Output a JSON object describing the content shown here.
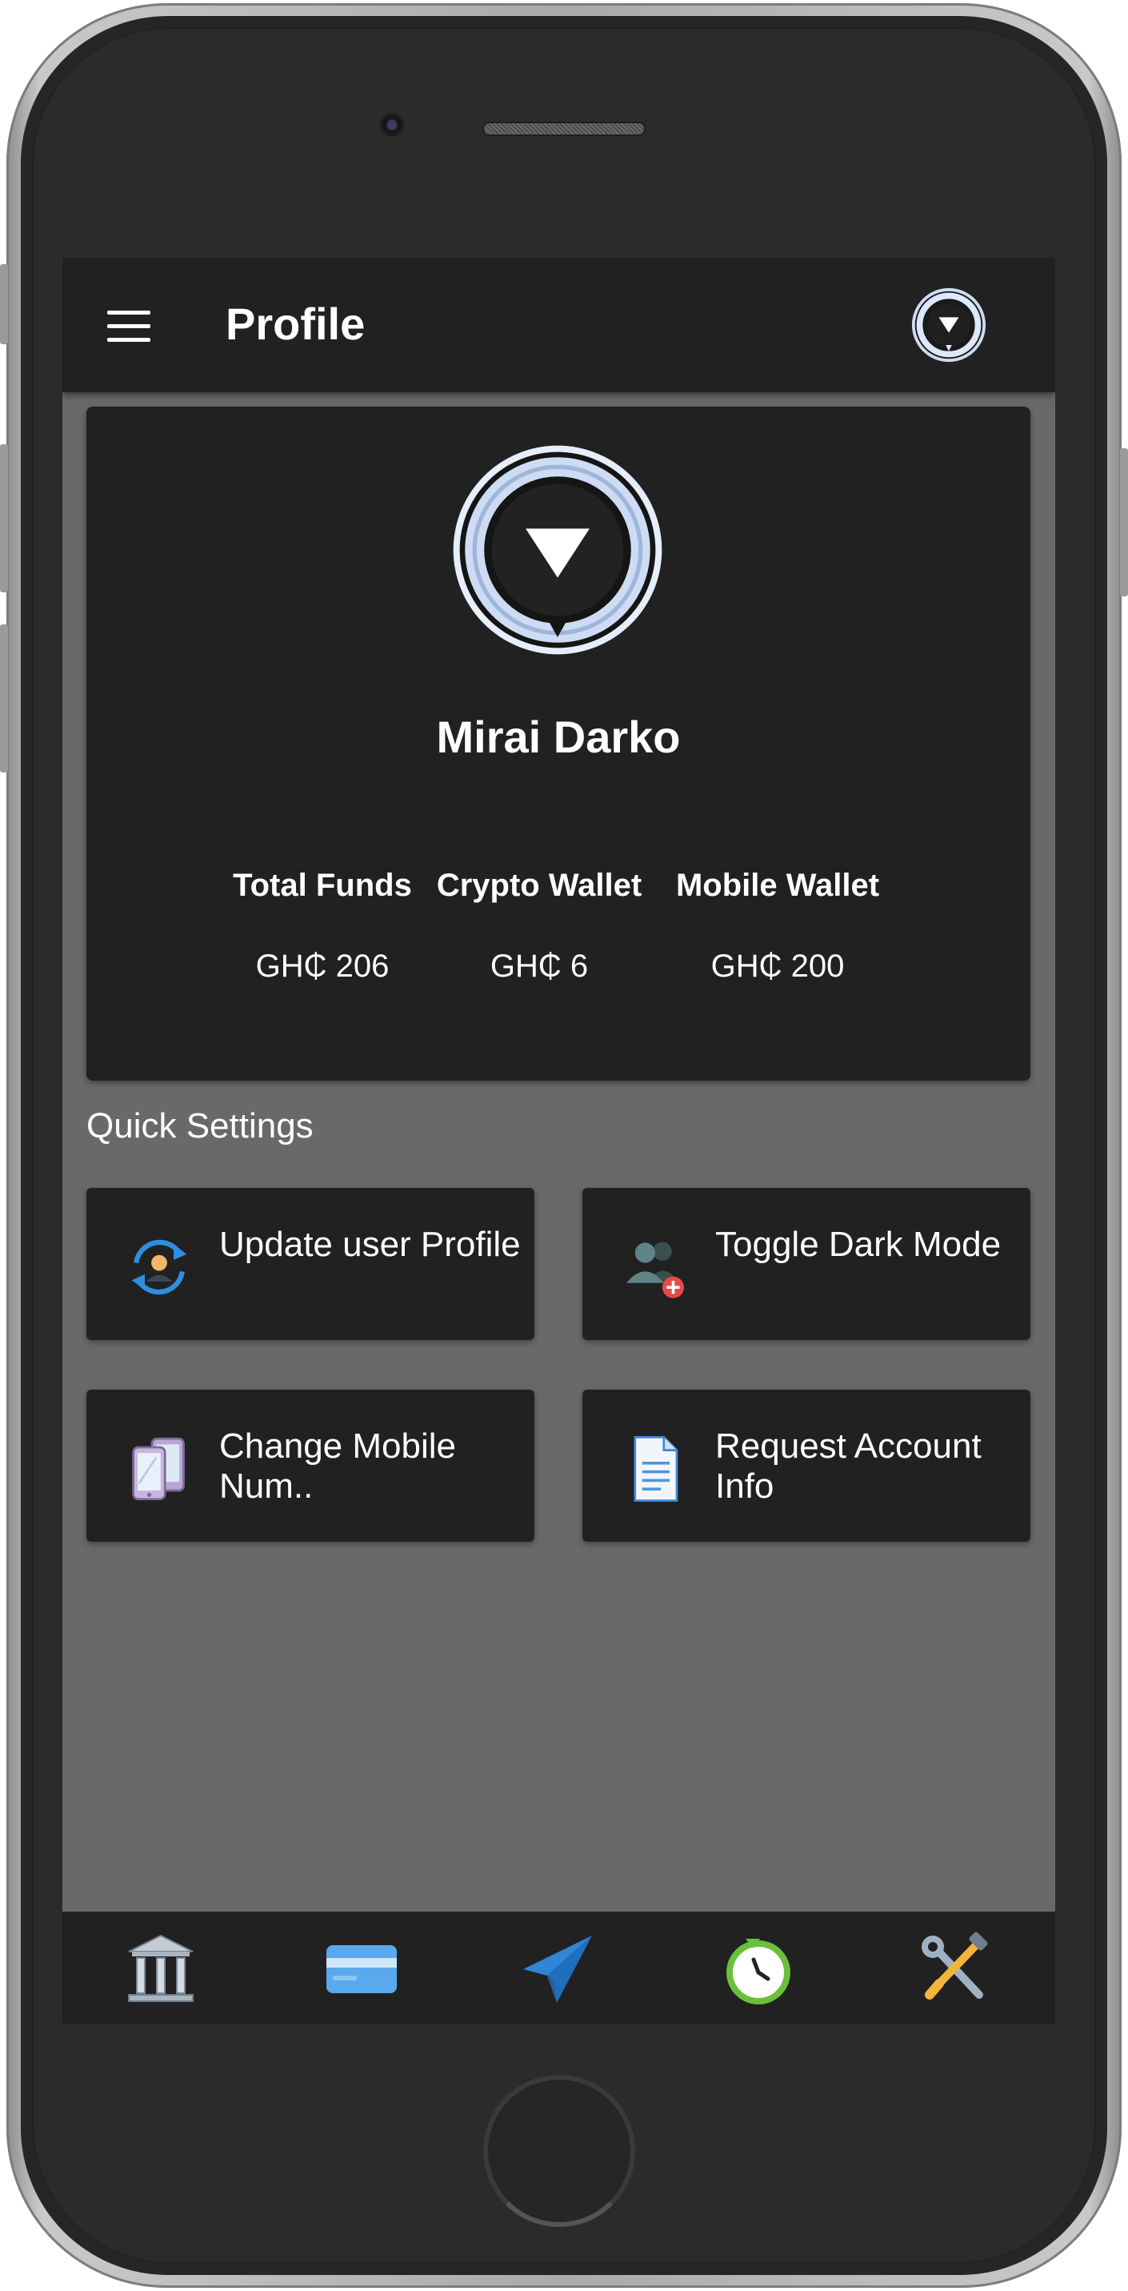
{
  "appbar": {
    "title": "Profile",
    "menu_icon": "hamburger-menu-icon",
    "logo_icon": "app-logo-icon"
  },
  "profile": {
    "avatar_icon": "app-logo-avatar",
    "name": "Mirai Darko",
    "stats": [
      {
        "label": "Total Funds",
        "value": "GH₵ 206"
      },
      {
        "label": "Crypto Wallet",
        "value": "GH₵ 6"
      },
      {
        "label": "Mobile Wallet",
        "value": "GH₵ 200"
      }
    ]
  },
  "quick_settings": {
    "title": "Quick Settings",
    "tiles": [
      {
        "label": "Update user Profile",
        "icon": "update-profile-icon"
      },
      {
        "label": "Toggle Dark Mode",
        "icon": "users-add-icon"
      },
      {
        "label": "Change Mobile Num..",
        "icon": "mobile-phones-icon"
      },
      {
        "label": "Request Account Info",
        "icon": "document-icon"
      }
    ]
  },
  "bottom_nav": [
    {
      "icon": "bank-icon"
    },
    {
      "icon": "credit-card-icon"
    },
    {
      "icon": "send-paper-plane-icon"
    },
    {
      "icon": "history-clock-icon"
    },
    {
      "icon": "tools-settings-icon"
    }
  ],
  "colors": {
    "app_bar": "#212121",
    "screen_background": "#696969",
    "card": "#212121",
    "text": "#ffffff"
  }
}
